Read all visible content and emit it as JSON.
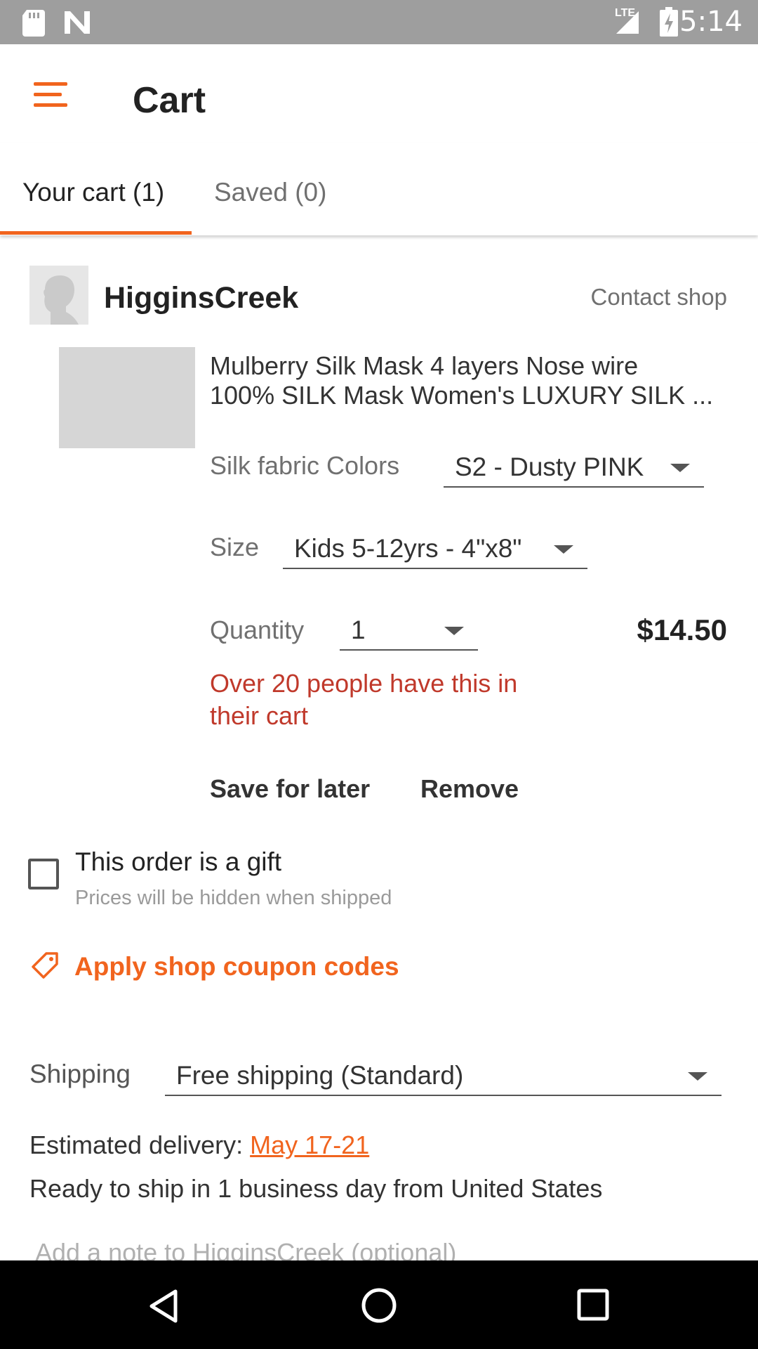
{
  "status_bar": {
    "time": "5:14",
    "network": "LTE"
  },
  "app_bar": {
    "title": "Cart"
  },
  "tabs": [
    {
      "label": "Your cart (1)",
      "active": true
    },
    {
      "label": "Saved (0)",
      "active": false
    }
  ],
  "shop": {
    "name": "HigginsCreek",
    "contact_label": "Contact shop"
  },
  "item": {
    "title_line1": "Mulberry Silk Mask 4 layers Nose wire",
    "title_line2": "100% SILK Mask Women's LUXURY SILK ...",
    "color_label": "Silk fabric Colors",
    "color_value": "S2 - Dusty PINK",
    "size_label": "Size",
    "size_value": "Kids 5-12yrs - 4\"x8\"",
    "quantity_label": "Quantity",
    "quantity_value": "1",
    "price": "$14.50",
    "urgency": "Over 20 people have this in their cart",
    "save_for_later": "Save for later",
    "remove": "Remove"
  },
  "gift": {
    "label": "This order is a gift",
    "sub": "Prices will be hidden when shipped",
    "checked": false
  },
  "coupon": {
    "label": "Apply shop coupon codes"
  },
  "shipping": {
    "label": "Shipping",
    "value": "Free shipping (Standard)",
    "estimated_label": "Estimated delivery:",
    "estimated_date": "May 17-21",
    "ready": "Ready to ship in 1 business day from United States",
    "note_placeholder": "Add a note to HigginsCreek (optional)"
  },
  "colors": {
    "accent": "#f1641e",
    "urgency": "#c0392b",
    "status_bar": "#9e9e9e"
  },
  "icons": [
    "sd-card-icon",
    "notification-n-icon",
    "signal-icon",
    "battery-charging-icon",
    "menu-icon",
    "avatar-icon",
    "tag-icon",
    "back-icon",
    "home-icon",
    "recents-icon"
  ]
}
